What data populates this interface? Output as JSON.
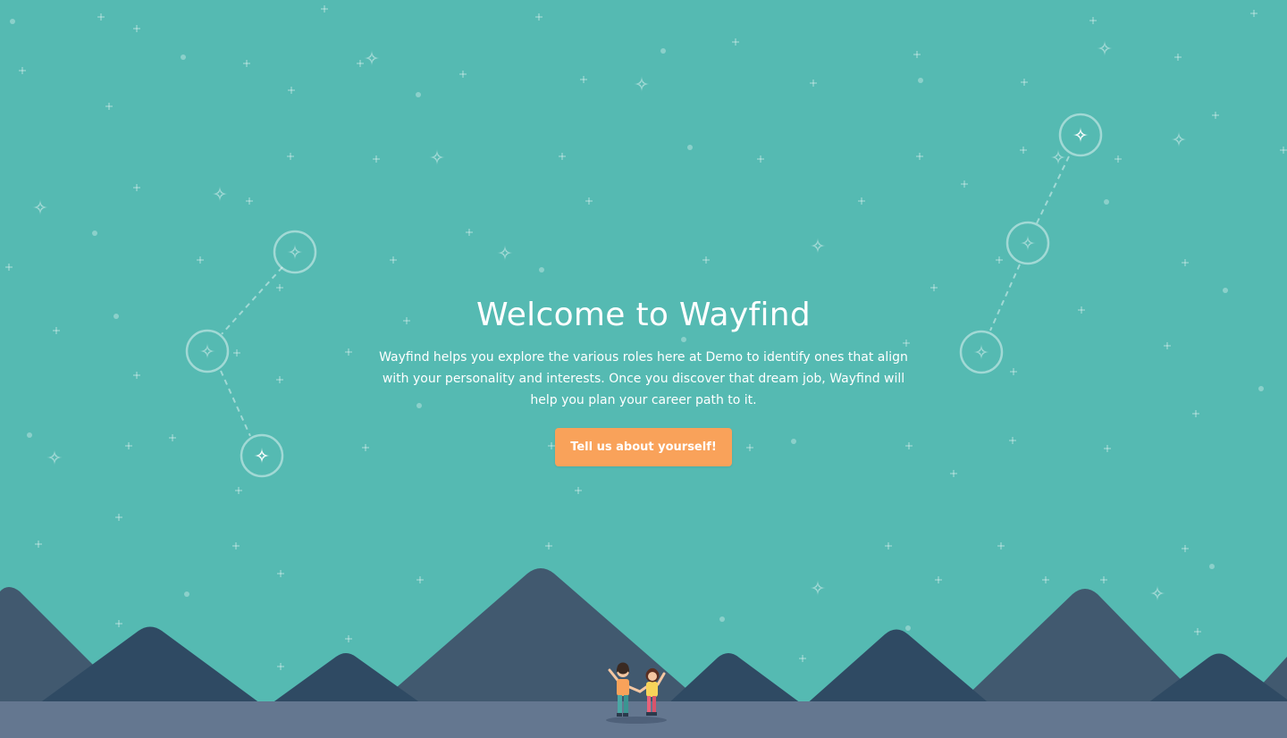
{
  "hero": {
    "title": "Welcome to Wayfind",
    "description": "Wayfind helps you explore the various roles here at Demo to identify ones that align with your personality and interests. Once you discover that dream job, Wayfind will help you plan your career path to it.",
    "cta_label": "Tell us about yourself!"
  },
  "colors": {
    "sky": "#55bab2",
    "mountain_light": "#41596f",
    "mountain_dark": "#2f4a63",
    "ground": "#647790",
    "cta": "#f9a25a",
    "text": "#ffffff"
  },
  "icons": [
    "sparkle-star-icon",
    "plus-star-icon",
    "dot-star-icon",
    "constellation-node-icon"
  ]
}
